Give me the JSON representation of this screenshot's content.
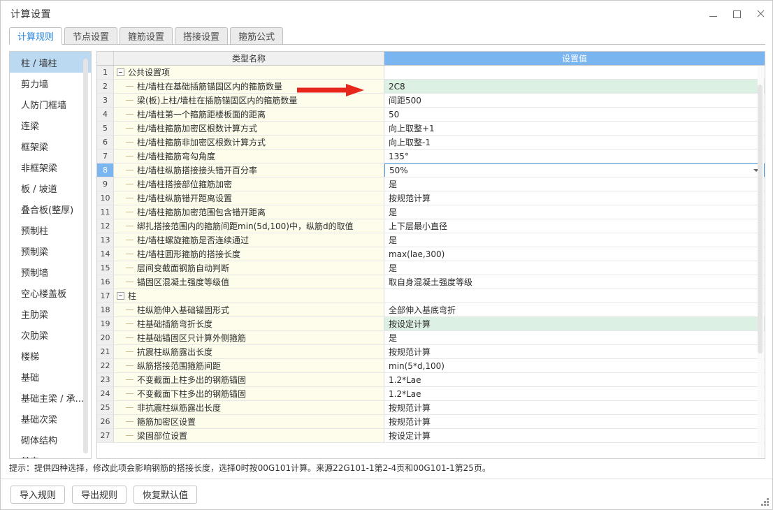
{
  "window": {
    "title": "计算设置",
    "controls": {
      "minimize": "minimize-icon",
      "maximize": "maximize-icon",
      "close": "close-icon"
    }
  },
  "tabs": [
    {
      "label": "计算规则",
      "active": true
    },
    {
      "label": "节点设置",
      "active": false
    },
    {
      "label": "箍筋设置",
      "active": false
    },
    {
      "label": "搭接设置",
      "active": false
    },
    {
      "label": "箍筋公式",
      "active": false
    }
  ],
  "sidebar": {
    "items": [
      {
        "label": "柱 / 墙柱",
        "active": true
      },
      {
        "label": "剪力墙",
        "active": false
      },
      {
        "label": "人防门框墙",
        "active": false
      },
      {
        "label": "连梁",
        "active": false
      },
      {
        "label": "框架梁",
        "active": false
      },
      {
        "label": "非框架梁",
        "active": false
      },
      {
        "label": "板 / 坡道",
        "active": false
      },
      {
        "label": "叠合板(整厚)",
        "active": false
      },
      {
        "label": "预制柱",
        "active": false
      },
      {
        "label": "预制梁",
        "active": false
      },
      {
        "label": "预制墙",
        "active": false
      },
      {
        "label": "空心楼盖板",
        "active": false
      },
      {
        "label": "主肋梁",
        "active": false
      },
      {
        "label": "次肋梁",
        "active": false
      },
      {
        "label": "楼梯",
        "active": false
      },
      {
        "label": "基础",
        "active": false
      },
      {
        "label": "基础主梁 / 承...",
        "active": false
      },
      {
        "label": "基础次梁",
        "active": false
      },
      {
        "label": "砌体结构",
        "active": false
      },
      {
        "label": "其它",
        "active": false
      }
    ]
  },
  "grid": {
    "headers": {
      "num": "",
      "name": "类型名称",
      "value": "设置值"
    },
    "rows": [
      {
        "num": "1",
        "kind": "group",
        "name": "公共设置项",
        "value": "",
        "valueHighlight": false,
        "selected": false,
        "editing": false
      },
      {
        "num": "2",
        "kind": "child",
        "name": "柱/墙柱在基础插筋锚固区内的箍筋数量",
        "value": "2C8",
        "valueHighlight": true,
        "selected": false,
        "editing": false
      },
      {
        "num": "3",
        "kind": "child",
        "name": "梁(板)上柱/墙柱在插筋锚固区内的箍筋数量",
        "value": "间距500",
        "valueHighlight": false,
        "selected": false,
        "editing": false
      },
      {
        "num": "4",
        "kind": "child",
        "name": "柱/墙柱第一个箍筋距楼板面的距离",
        "value": "50",
        "valueHighlight": false,
        "selected": false,
        "editing": false
      },
      {
        "num": "5",
        "kind": "child",
        "name": "柱/墙柱箍筋加密区根数计算方式",
        "value": "向上取整+1",
        "valueHighlight": false,
        "selected": false,
        "editing": false
      },
      {
        "num": "6",
        "kind": "child",
        "name": "柱/墙柱箍筋非加密区根数计算方式",
        "value": "向上取整-1",
        "valueHighlight": false,
        "selected": false,
        "editing": false
      },
      {
        "num": "7",
        "kind": "child",
        "name": "柱/墙柱箍筋弯勾角度",
        "value": "135°",
        "valueHighlight": false,
        "selected": false,
        "editing": false
      },
      {
        "num": "8",
        "kind": "child",
        "name": "柱/墙柱纵筋搭接接头错开百分率",
        "value": "50%",
        "valueHighlight": false,
        "selected": true,
        "editing": true
      },
      {
        "num": "9",
        "kind": "child",
        "name": "柱/墙柱搭接部位箍筋加密",
        "value": "是",
        "valueHighlight": false,
        "selected": false,
        "editing": false
      },
      {
        "num": "10",
        "kind": "child",
        "name": "柱/墙柱纵筋错开距离设置",
        "value": "按规范计算",
        "valueHighlight": false,
        "selected": false,
        "editing": false
      },
      {
        "num": "11",
        "kind": "child",
        "name": "柱/墙柱箍筋加密范围包含错开距离",
        "value": "是",
        "valueHighlight": false,
        "selected": false,
        "editing": false
      },
      {
        "num": "12",
        "kind": "child",
        "name": "绑扎搭接范围内的箍筋间距min(5d,100)中，纵筋d的取值",
        "value": "上下层最小直径",
        "valueHighlight": false,
        "selected": false,
        "editing": false
      },
      {
        "num": "13",
        "kind": "child",
        "name": "柱/墙柱螺旋箍筋是否连续通过",
        "value": "是",
        "valueHighlight": false,
        "selected": false,
        "editing": false
      },
      {
        "num": "14",
        "kind": "child",
        "name": "柱/墙柱圆形箍筋的搭接长度",
        "value": "max(lae,300)",
        "valueHighlight": false,
        "selected": false,
        "editing": false
      },
      {
        "num": "15",
        "kind": "child",
        "name": "层间变截面钢筋自动判断",
        "value": "是",
        "valueHighlight": false,
        "selected": false,
        "editing": false
      },
      {
        "num": "16",
        "kind": "child",
        "name": "锚固区混凝土强度等级值",
        "value": "取自身混凝土强度等级",
        "valueHighlight": false,
        "selected": false,
        "editing": false
      },
      {
        "num": "17",
        "kind": "group",
        "name": "柱",
        "value": "",
        "valueHighlight": false,
        "selected": false,
        "editing": false
      },
      {
        "num": "18",
        "kind": "child",
        "name": "柱纵筋伸入基础锚固形式",
        "value": "全部伸入基底弯折",
        "valueHighlight": false,
        "selected": false,
        "editing": false
      },
      {
        "num": "19",
        "kind": "child",
        "name": "柱基础插筋弯折长度",
        "value": "按设定计算",
        "valueHighlight": true,
        "selected": false,
        "editing": false
      },
      {
        "num": "20",
        "kind": "child",
        "name": "柱基础锚固区只计算外侧箍筋",
        "value": "是",
        "valueHighlight": false,
        "selected": false,
        "editing": false
      },
      {
        "num": "21",
        "kind": "child",
        "name": "抗震柱纵筋露出长度",
        "value": "按规范计算",
        "valueHighlight": false,
        "selected": false,
        "editing": false
      },
      {
        "num": "22",
        "kind": "child",
        "name": "纵筋搭接范围箍筋间距",
        "value": "min(5*d,100)",
        "valueHighlight": false,
        "selected": false,
        "editing": false
      },
      {
        "num": "23",
        "kind": "child",
        "name": "不变截面上柱多出的钢筋锚固",
        "value": "1.2*Lae",
        "valueHighlight": false,
        "selected": false,
        "editing": false
      },
      {
        "num": "24",
        "kind": "child",
        "name": "不变截面下柱多出的钢筋锚固",
        "value": "1.2*Lae",
        "valueHighlight": false,
        "selected": false,
        "editing": false
      },
      {
        "num": "25",
        "kind": "child",
        "name": "非抗震柱纵筋露出长度",
        "value": "按规范计算",
        "valueHighlight": false,
        "selected": false,
        "editing": false
      },
      {
        "num": "26",
        "kind": "child",
        "name": "箍筋加密区设置",
        "value": "按规范计算",
        "valueHighlight": false,
        "selected": false,
        "editing": false
      },
      {
        "num": "27",
        "kind": "child",
        "name": "梁固部位设置",
        "value": "按设定计算",
        "valueHighlight": false,
        "selected": false,
        "editing": false
      }
    ]
  },
  "hint": {
    "text": "提示：提供四种选择，修改此项会影响钢筋的搭接长度，选择0时按00G101计算。来源22G101-1第2-4页和00G101-1第25页。"
  },
  "footer": {
    "buttons": [
      {
        "label": "导入规则"
      },
      {
        "label": "导出规则"
      },
      {
        "label": "恢复默认值"
      }
    ]
  },
  "annotation": {
    "arrow_color": "#e8271c",
    "points_to_row": "2"
  },
  "colors": {
    "accent": "#7ab5ef",
    "tab_active_text": "#2b8ae0",
    "sidebar_active": "#bcd9f2",
    "name_cell_bg": "#fefdec",
    "value_highlight_bg": "#ddf0e4",
    "arrow_red": "#e8271c"
  }
}
